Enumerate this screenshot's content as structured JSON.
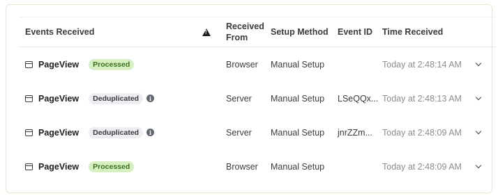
{
  "header": {
    "events_received": "Events Received",
    "received_from": "Received From",
    "setup_method": "Setup Method",
    "event_id": "Event ID",
    "time_received": "Time Received",
    "warning_icon": "warning-icon"
  },
  "rows": [
    {
      "event": "PageView",
      "status": "Processed",
      "status_type": "processed",
      "received_from": "Browser",
      "setup_method": "Manual Setup",
      "event_id": "",
      "time": "Today at 2:48:14 AM"
    },
    {
      "event": "PageView",
      "status": "Deduplicated",
      "status_type": "dedup",
      "received_from": "Server",
      "setup_method": "Manual Setup",
      "event_id": "LSeQQx...",
      "time": "Today at 2:48:13 AM"
    },
    {
      "event": "PageView",
      "status": "Deduplicated",
      "status_type": "dedup",
      "received_from": "Server",
      "setup_method": "Manual Setup",
      "event_id": "jnrZZm...",
      "time": "Today at 2:48:09 AM"
    },
    {
      "event": "PageView",
      "status": "Processed",
      "status_type": "processed",
      "received_from": "Browser",
      "setup_method": "Manual Setup",
      "event_id": "",
      "time": "Today at 2:48:09 AM"
    }
  ],
  "colors": {
    "processed_bg": "#d6f0c2",
    "processed_text": "#3b6e1d",
    "dedup_bg": "#eceef1",
    "card_border": "#efe3cc"
  }
}
